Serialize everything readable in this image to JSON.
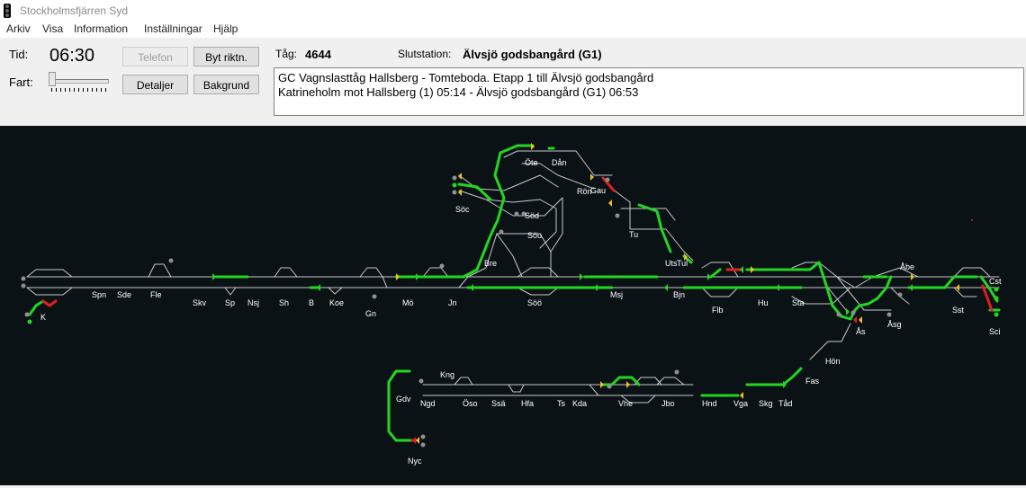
{
  "window": {
    "title": "Stockholmsfjärren Syd"
  },
  "menu": [
    "Arkiv",
    "Visa",
    "Information",
    "Inställningar",
    "Hjälp"
  ],
  "controls": {
    "time_label": "Tid:",
    "time_value": "06:30",
    "speed_label": "Fart:",
    "speed_level": 0,
    "buttons": {
      "telefon": "Telefon",
      "byt_riktn": "Byt riktn.",
      "detaljer": "Detaljer",
      "bakgrund": "Bakgrund"
    }
  },
  "train": {
    "label": "Tåg:",
    "number": "4644",
    "destination_label": "Slutstation:",
    "destination": "Älvsjö godsbangård (G1)",
    "description_line1": "GC Vagnslasttåg Hallsberg - Tomteboda. Etapp 1 till Älvsjö godsbangård",
    "description_line2": "Katrineholm mot Hallsberg (1) 05:14 - Älvsjö godsbangård (G1) 06:53"
  },
  "colors": {
    "map_background": "#0b1216",
    "track_free": "#c8c8c8",
    "track_set": "#22d622",
    "track_occupied": "#e02020",
    "signal_green": "#22d622",
    "signal_yellow": "#f0c020",
    "signal_red": "#e02020"
  },
  "stations": {
    "K": "K",
    "Spn": "Spn",
    "Sde": "Sde",
    "Fle": "Fle",
    "Skv": "Skv",
    "Sp": "Sp",
    "Nsj": "Nsj",
    "Sh": "Sh",
    "B": "B",
    "Koe": "Koe",
    "Gn": "Gn",
    "Mö": "Mö",
    "Jn": "Jn",
    "Bre": "Bre",
    "Söö": "Söö",
    "Msj": "Msj",
    "Bjn": "Bjn",
    "Flb": "Flb",
    "Hu": "Hu",
    "Sta": "Sta",
    "Ås": "Ås",
    "Åsg": "Åsg",
    "Åbe": "Åbe",
    "Sst": "Sst",
    "Cst": "Cst",
    "Sci": "Sci",
    "Öte": "Öte",
    "Dån": "Dån",
    "Rön": "Rön",
    "Gau": "Gau",
    "Tu": "Tu",
    "Söc": "Söc",
    "Söd": "Söd",
    "Sou": "Söu",
    "Uts": "Uts",
    "Tul": "Tul",
    "Hön": "Hön",
    "Fas": "Fas",
    "Tåd": "Tåd",
    "Skg": "Skg",
    "Vga": "Vga",
    "Hnd": "Hnd",
    "Jbo": "Jbo",
    "Vhe": "Vhe",
    "Kda": "Kda",
    "Ts": "Ts",
    "Hfa": "Hfa",
    "Ssä": "Ssä",
    "Öso": "Öso",
    "Kng": "Kng",
    "Ngd": "Ngd",
    "Gdv": "Gdv",
    "Nyc": "Nyc"
  }
}
